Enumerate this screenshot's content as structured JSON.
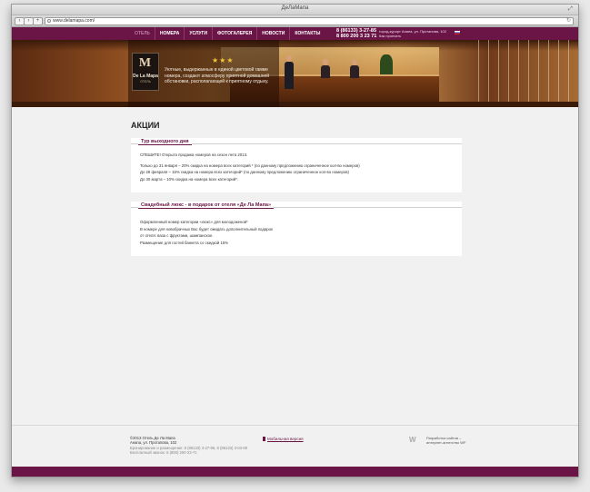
{
  "browser": {
    "window_title": "ДеЛаМапа",
    "url": "www.delamapa.com/"
  },
  "nav": {
    "items": [
      "ОТЕЛЬ",
      "НОМЕРА",
      "УСЛУГИ",
      "ФОТОГАЛЕРЕЯ",
      "НОВОСТИ",
      "КОНТАКТЫ"
    ],
    "phone1": "8 (86133) 3-27-85",
    "phone2": "8 800 200 3 23 71",
    "address_line1": "город-курорт Анапа, ул. Протапова, 102",
    "address_line2": "Как проехать"
  },
  "hero": {
    "logo_mark": "M",
    "logo_name": "De La Mapa",
    "logo_sub": "ОТЕЛЬ",
    "stars": "★★★",
    "tagline": "Уютные, выдержанные в единой цветовой гамме номера, создают атмосферу приятной домашней обстановки, располагающей к приятному отдыху."
  },
  "page": {
    "title": "АКЦИИ"
  },
  "sections": [
    {
      "title": "Тур выходного дня",
      "lines": [
        "СПЕШИТЕ!  Открыта продажа номеров на сезон лета 2013.",
        "Только до 31 января – 20% скидка на номера всех категорий * (по данному предложению ограниченное кол-во номеров)",
        "До 28 февраля – 15% скидка на номера всех категорий*  (по данному предложению ограниченное кол-во номеров)",
        "До 30 марта – 10% скидка на номера всех категорий*."
      ]
    },
    {
      "title": "Свадебный люкс - в подарок от отеля «Де Ла Мапа»",
      "lines": [
        "Оформленный номер категории «люкс» для молодоженов*",
        "В номере для новобрачных Вас будет ожидать дополнительный подарок",
        "от отеля: ваза с фруктами, шампанское.",
        "Размещение для гостей банкета со скидкой 15%"
      ]
    }
  ],
  "footer": {
    "copyright": "©2013 Отель Де Ла Мапа",
    "address": "Анапа, ул. Протапова, 102",
    "booking": "Бронирование и размещение: 8 (86133) 3-27-85, 8 (86133) 3-03-09",
    "free_call": "Бесплатный звонок: 8 (800) 200-23-71",
    "mobile_link": "Мобильная версия",
    "dev_line1": "Разработка сайтов –",
    "dev_line2": "интернет-агентство WF"
  },
  "colors": {
    "brand": "#6b1547",
    "accent_gold": "#f2c832"
  }
}
